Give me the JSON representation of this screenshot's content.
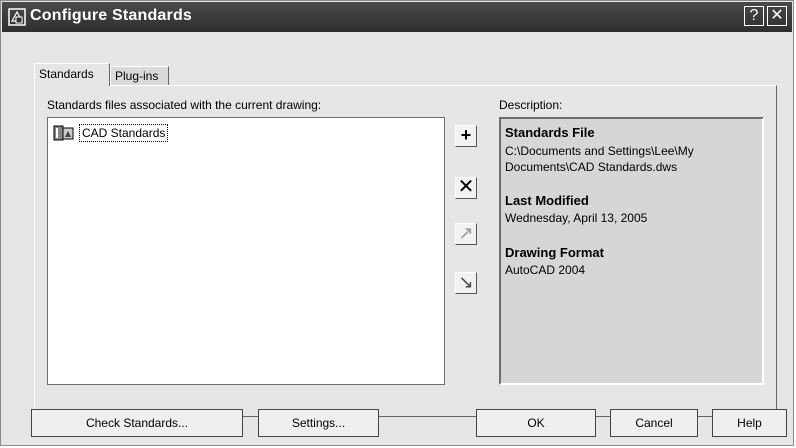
{
  "window": {
    "title": "Configure Standards",
    "help_glyph": "?",
    "close_glyph": "✕"
  },
  "tabs": [
    {
      "label": "Standards"
    },
    {
      "label": "Plug-ins"
    }
  ],
  "files_label": "Standards files associated with the current drawing:",
  "description_label": "Description:",
  "files_list": {
    "items": [
      {
        "label": "CAD Standards"
      }
    ]
  },
  "side_buttons": {
    "add": "+",
    "remove": "✕",
    "up": "↗",
    "down": "↘"
  },
  "description": {
    "standards_file_heading": "Standards File",
    "standards_file_path": "C:\\Documents and Settings\\Lee\\My Documents\\CAD Standards.dws",
    "last_modified_heading": "Last Modified",
    "last_modified_value": "Wednesday, April 13, 2005",
    "drawing_format_heading": "Drawing Format",
    "drawing_format_value": "AutoCAD 2004"
  },
  "buttons": {
    "check_standards": "Check Standards...",
    "settings": "Settings...",
    "ok": "OK",
    "cancel": "Cancel",
    "help": "Help"
  },
  "colors": {
    "titlebar": "#3a3a3a",
    "dialog_bg": "#e6e6e6",
    "description_bg": "#d6d6d6"
  }
}
